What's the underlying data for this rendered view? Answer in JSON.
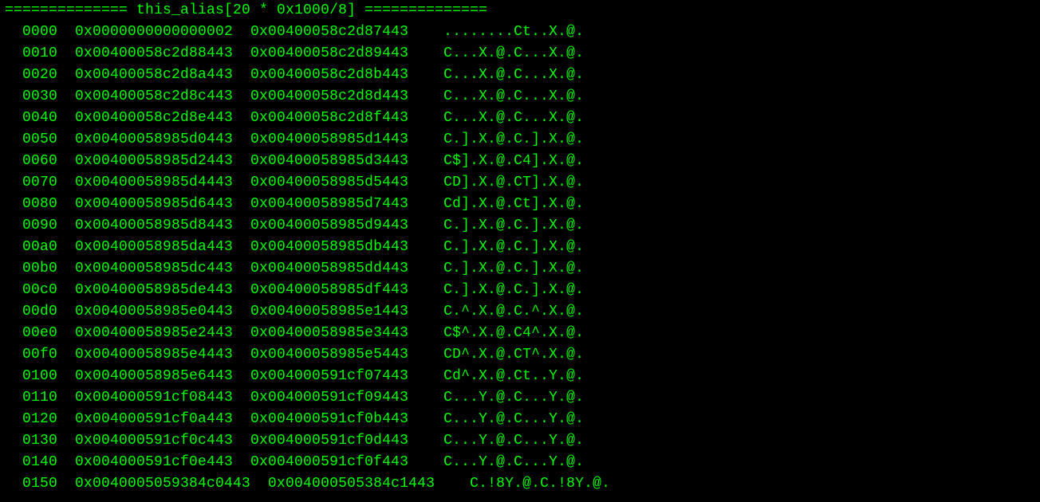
{
  "header": {
    "left_rule": "==============",
    "title": "this_alias[20 * 0x1000/8]",
    "right_rule": "=============="
  },
  "rows": [
    {
      "offset": "0000",
      "a": "0x0000000000000002",
      "b": "0x00400058c2d87443",
      "ascii": "........Ct..X.@."
    },
    {
      "offset": "0010",
      "a": "0x00400058c2d88443",
      "b": "0x00400058c2d89443",
      "ascii": "C...X.@.C...X.@."
    },
    {
      "offset": "0020",
      "a": "0x00400058c2d8a443",
      "b": "0x00400058c2d8b443",
      "ascii": "C...X.@.C...X.@."
    },
    {
      "offset": "0030",
      "a": "0x00400058c2d8c443",
      "b": "0x00400058c2d8d443",
      "ascii": "C...X.@.C...X.@."
    },
    {
      "offset": "0040",
      "a": "0x00400058c2d8e443",
      "b": "0x00400058c2d8f443",
      "ascii": "C...X.@.C...X.@."
    },
    {
      "offset": "0050",
      "a": "0x00400058985d0443",
      "b": "0x00400058985d1443",
      "ascii": "C.].X.@.C.].X.@."
    },
    {
      "offset": "0060",
      "a": "0x00400058985d2443",
      "b": "0x00400058985d3443",
      "ascii": "C$].X.@.C4].X.@."
    },
    {
      "offset": "0070",
      "a": "0x00400058985d4443",
      "b": "0x00400058985d5443",
      "ascii": "CD].X.@.CT].X.@."
    },
    {
      "offset": "0080",
      "a": "0x00400058985d6443",
      "b": "0x00400058985d7443",
      "ascii": "Cd].X.@.Ct].X.@."
    },
    {
      "offset": "0090",
      "a": "0x00400058985d8443",
      "b": "0x00400058985d9443",
      "ascii": "C.].X.@.C.].X.@."
    },
    {
      "offset": "00a0",
      "a": "0x00400058985da443",
      "b": "0x00400058985db443",
      "ascii": "C.].X.@.C.].X.@."
    },
    {
      "offset": "00b0",
      "a": "0x00400058985dc443",
      "b": "0x00400058985dd443",
      "ascii": "C.].X.@.C.].X.@."
    },
    {
      "offset": "00c0",
      "a": "0x00400058985de443",
      "b": "0x00400058985df443",
      "ascii": "C.].X.@.C.].X.@."
    },
    {
      "offset": "00d0",
      "a": "0x00400058985e0443",
      "b": "0x00400058985e1443",
      "ascii": "C.^.X.@.C.^.X.@."
    },
    {
      "offset": "00e0",
      "a": "0x00400058985e2443",
      "b": "0x00400058985e3443",
      "ascii": "C$^.X.@.C4^.X.@."
    },
    {
      "offset": "00f0",
      "a": "0x00400058985e4443",
      "b": "0x00400058985e5443",
      "ascii": "CD^.X.@.CT^.X.@."
    },
    {
      "offset": "0100",
      "a": "0x00400058985e6443",
      "b": "0x004000591cf07443",
      "ascii": "Cd^.X.@.Ct..Y.@."
    },
    {
      "offset": "0110",
      "a": "0x004000591cf08443",
      "b": "0x004000591cf09443",
      "ascii": "C...Y.@.C...Y.@."
    },
    {
      "offset": "0120",
      "a": "0x004000591cf0a443",
      "b": "0x004000591cf0b443",
      "ascii": "C...Y.@.C...Y.@."
    },
    {
      "offset": "0130",
      "a": "0x004000591cf0c443",
      "b": "0x004000591cf0d443",
      "ascii": "C...Y.@.C...Y.@."
    },
    {
      "offset": "0140",
      "a": "0x004000591cf0e443",
      "b": "0x004000591cf0f443",
      "ascii": "C...Y.@.C...Y.@."
    },
    {
      "offset": "0150",
      "a": "0x0040005059384c0443",
      "b": "0x004000505384c1443",
      "ascii": "C.!8Y.@.C.!8Y.@."
    }
  ]
}
